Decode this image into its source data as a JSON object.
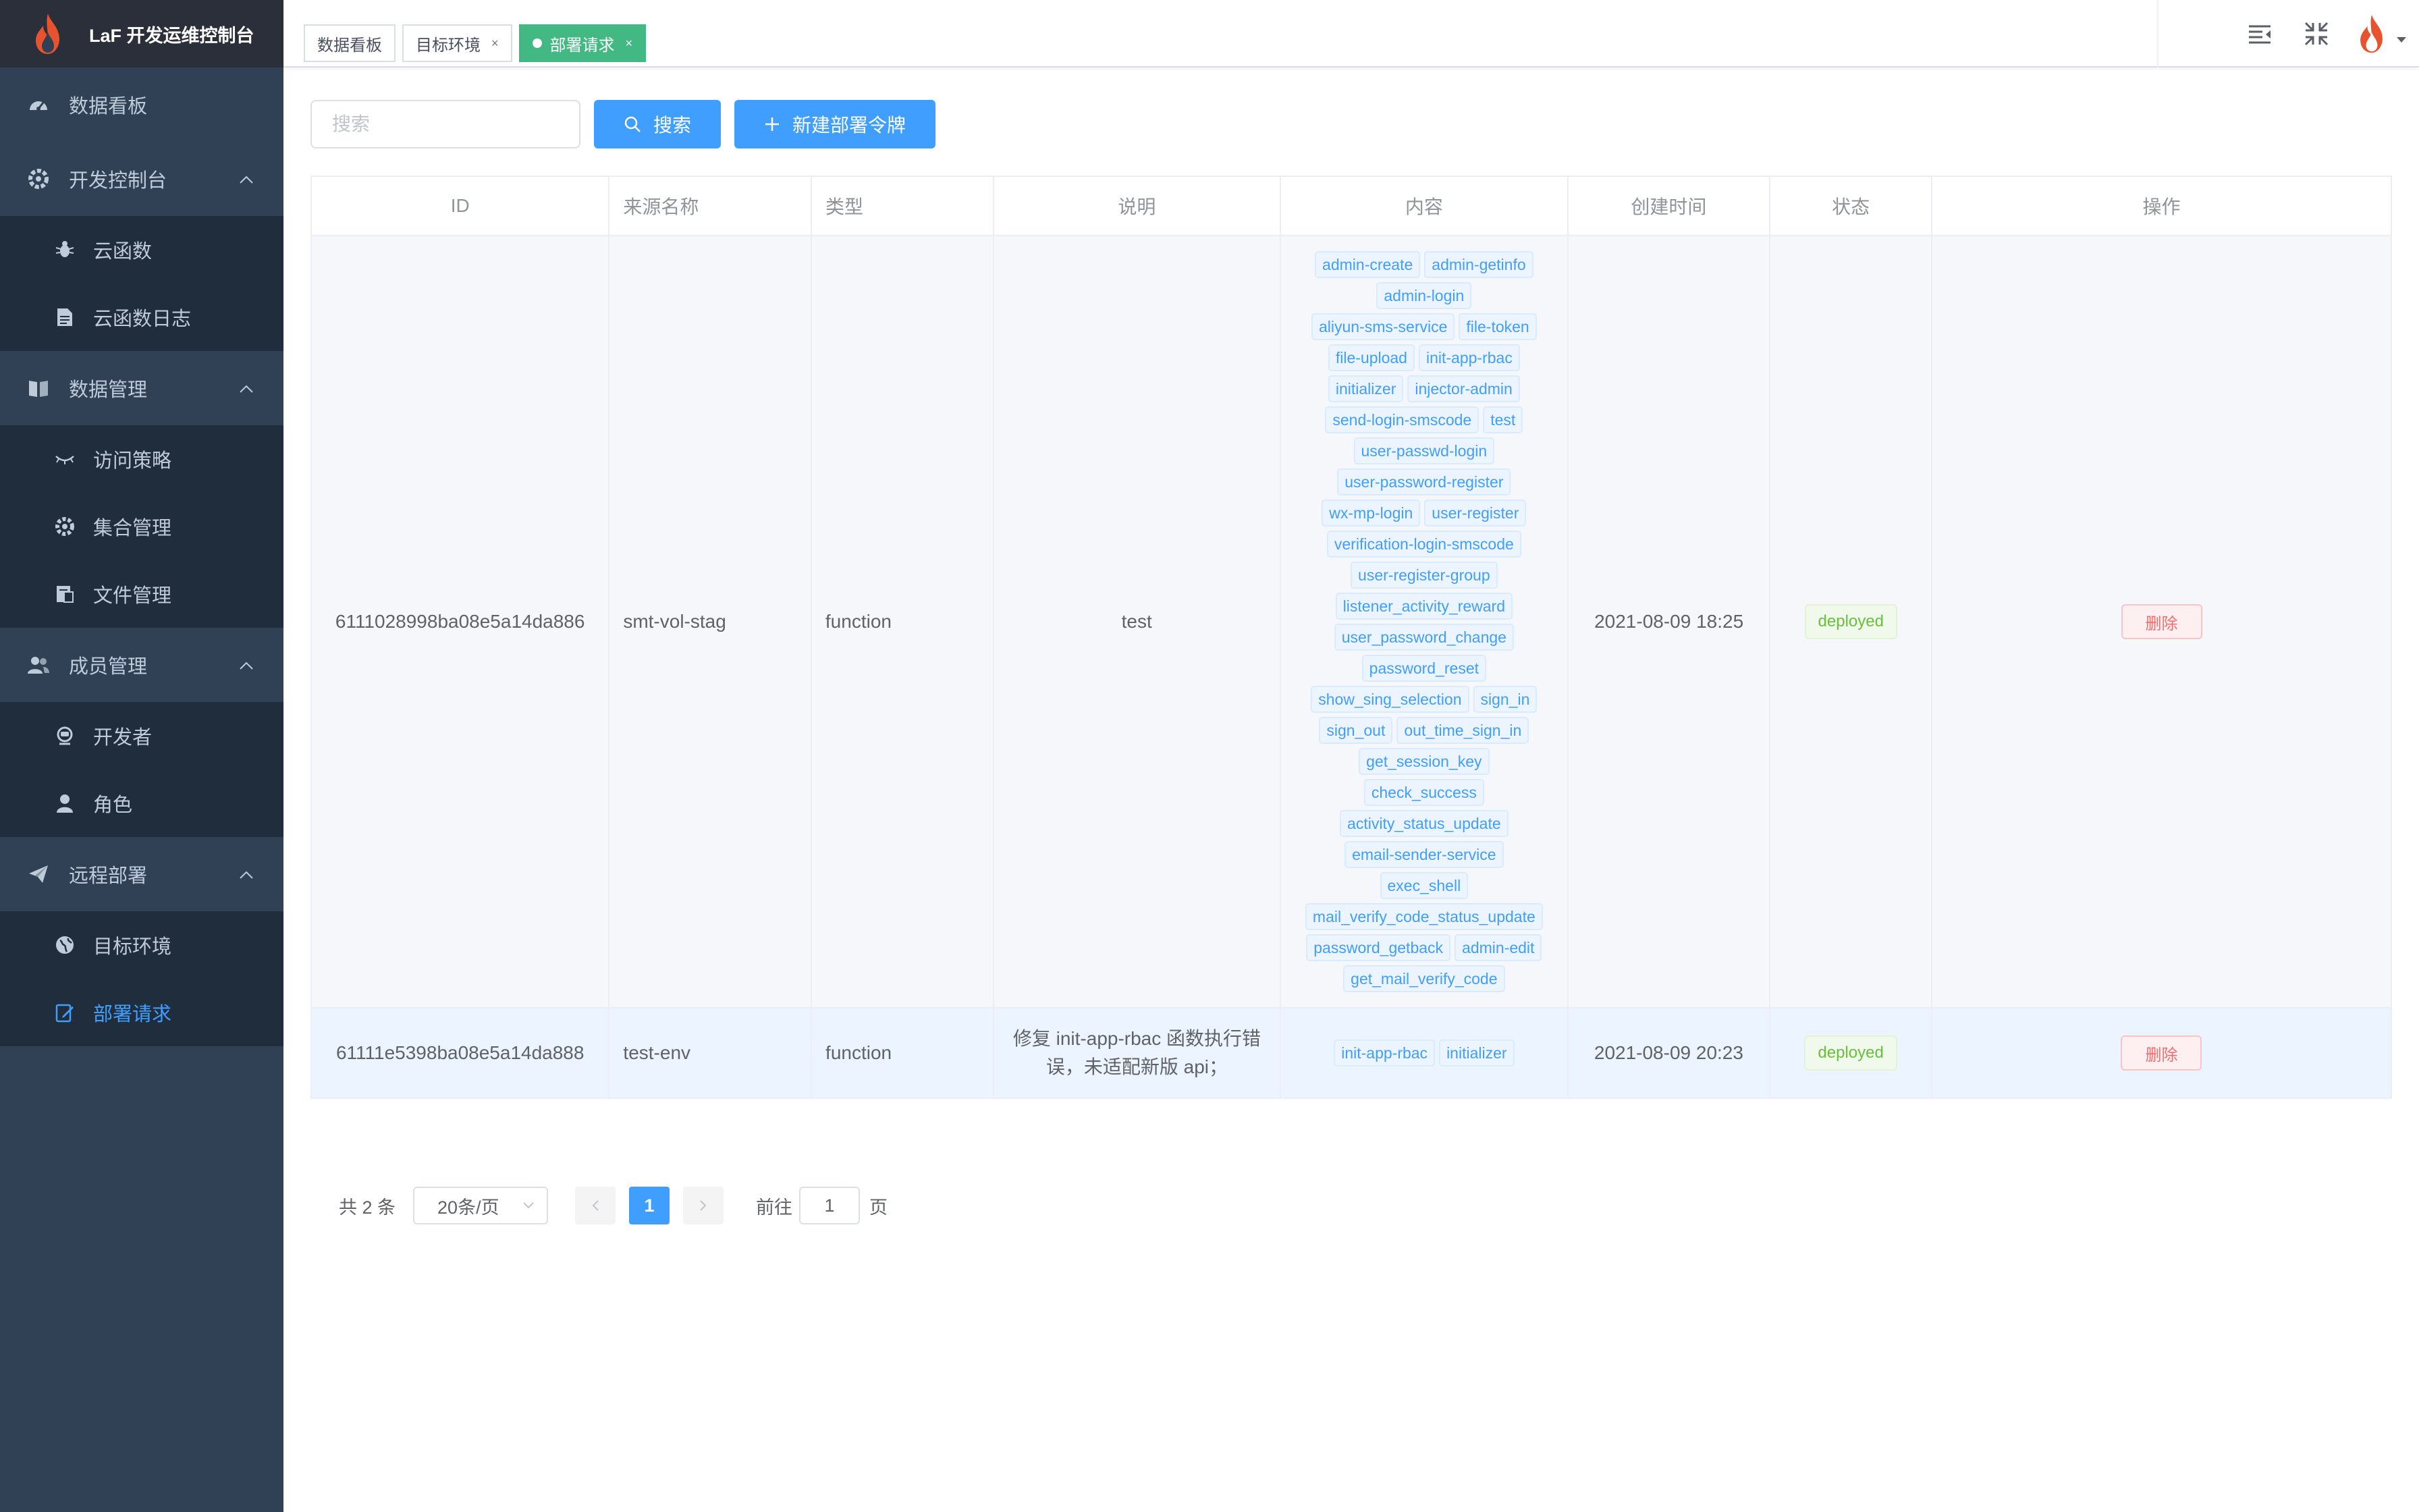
{
  "app": {
    "title": "LaF 开发运维控制台"
  },
  "sidebar": {
    "dashboard": "数据看板",
    "dev_console": {
      "label": "开发控制台",
      "items": [
        "云函数",
        "云函数日志"
      ]
    },
    "data_mgmt": {
      "label": "数据管理",
      "items": [
        "访问策略",
        "集合管理",
        "文件管理"
      ]
    },
    "member_mgmt": {
      "label": "成员管理",
      "items": [
        "开发者",
        "角色"
      ]
    },
    "remote_deploy": {
      "label": "远程部署",
      "items": [
        "目标环境",
        "部署请求"
      ]
    }
  },
  "tabs": [
    {
      "label": "数据看板",
      "active": false,
      "closable": false
    },
    {
      "label": "目标环境",
      "active": false,
      "closable": true
    },
    {
      "label": "部署请求",
      "active": true,
      "closable": true
    }
  ],
  "toolbar": {
    "search_placeholder": "搜索",
    "search_value": "",
    "search_button": "搜索",
    "new_button": "新建部署令牌"
  },
  "table": {
    "headers": [
      "ID",
      "来源名称",
      "类型",
      "说明",
      "内容",
      "创建时间",
      "状态",
      "操作"
    ],
    "rows": [
      {
        "id": "6111028998ba08e5a14da886",
        "source": "smt-vol-stag",
        "type": "function",
        "description": "test",
        "content": [
          "admin-create",
          "admin-getinfo",
          "admin-login",
          "aliyun-sms-service",
          "file-token",
          "file-upload",
          "init-app-rbac",
          "initializer",
          "injector-admin",
          "send-login-smscode",
          "test",
          "user-passwd-login",
          "user-password-register",
          "wx-mp-login",
          "user-register",
          "verification-login-smscode",
          "user-register-group",
          "listener_activity_reward",
          "user_password_change",
          "password_reset",
          "show_sing_selection",
          "sign_in",
          "sign_out",
          "out_time_sign_in",
          "get_session_key",
          "check_success",
          "activity_status_update",
          "email-sender-service",
          "exec_shell",
          "mail_verify_code_status_update",
          "password_getback",
          "admin-edit",
          "get_mail_verify_code"
        ],
        "created_at": "2021-08-09 18:25",
        "status": "deployed",
        "action": "删除"
      },
      {
        "id": "61111e5398ba08e5a14da888",
        "source": "test-env",
        "type": "function",
        "description": "修复 init-app-rbac 函数执行错误，未适配新版 api；",
        "content": [
          "init-app-rbac",
          "initializer"
        ],
        "created_at": "2021-08-09 20:23",
        "status": "deployed",
        "action": "删除"
      }
    ]
  },
  "pagination": {
    "total_text": "共 2 条",
    "page_size": "20条/页",
    "current_page": "1",
    "goto_label": "前往",
    "goto_value": "1",
    "page_unit": "页"
  },
  "colors": {
    "sidebar_bg": "#304156",
    "accent": "#409eff",
    "active_tab": "#42b983",
    "danger": "#f56c6c",
    "success": "#67c23a"
  }
}
